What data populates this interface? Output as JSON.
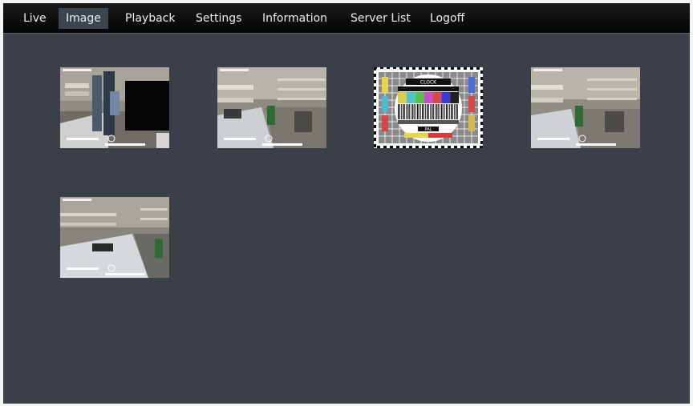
{
  "nav": {
    "items": [
      {
        "label": "Live"
      },
      {
        "label": "Image",
        "active": true
      },
      {
        "label": "Playback"
      },
      {
        "label": "Settings"
      },
      {
        "label": "Information"
      },
      {
        "label": "Server List"
      },
      {
        "label": "Logoff"
      }
    ]
  },
  "snapshots": [
    {
      "kind": "camera"
    },
    {
      "kind": "camera"
    },
    {
      "kind": "test-pattern",
      "center_label": "CLOCK",
      "bottom_label": "PAL"
    },
    {
      "kind": "camera"
    },
    {
      "kind": "camera"
    }
  ],
  "colors": {
    "background": "#3a3f48",
    "navbar": "#0b0b0b",
    "active_tab": "#3c4450",
    "nav_text": "#ececec"
  }
}
